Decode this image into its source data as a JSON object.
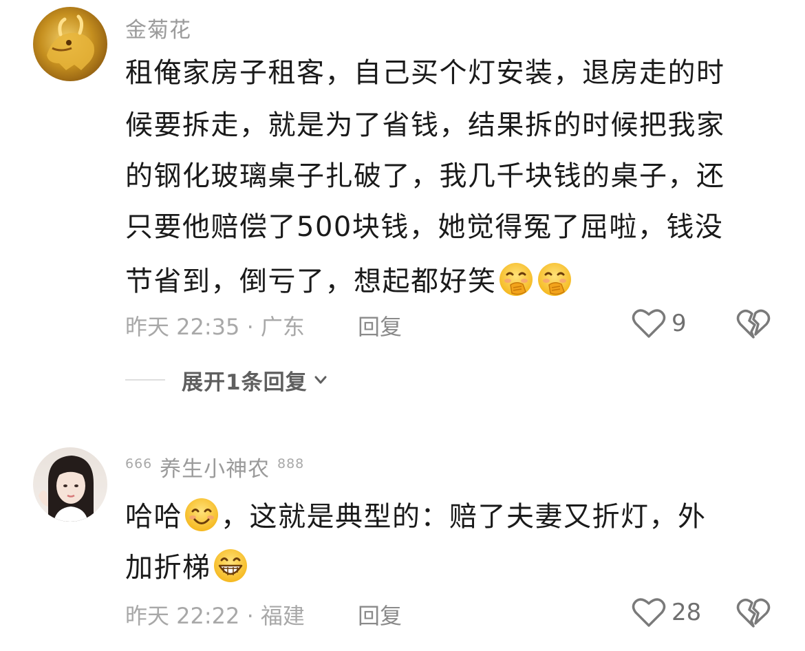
{
  "comments": [
    {
      "username": "金菊花",
      "avatar_icon": "golden-ox-avatar",
      "lines": [
        "租俺家房子租客，自己买个灯安装，退房走的时",
        "候要拆走，就是为了省钱，结果拆的时候把我家",
        "的钢化玻璃桌子扎破了，我几千块钱的桌子，还",
        "只要他赔偿了500块钱，她觉得冤了屈啦，钱没",
        "节省到，倒亏了，想起都好笑"
      ],
      "trailing_emojis": [
        "covering-mouth-laughing-emoji",
        "covering-mouth-laughing-emoji"
      ],
      "time_location": "昨天 22:35 · 广东",
      "reply_label": "回复",
      "like_count": "9",
      "expand_label": "展开1条回复"
    },
    {
      "badge_left": "666",
      "username": "养生小神农",
      "badge_right": "888",
      "avatar_icon": "girl-portrait-avatar",
      "line1_prefix": "哈哈",
      "line1_emoji": "smiling-face-emoji",
      "line1_suffix": "，这就是典型的：赔了夫妻又折灯，外",
      "line2_text": "加折梯",
      "line2_emoji": "grinning-face-emoji",
      "time_location": "昨天 22:22 · 福建",
      "reply_label": "回复",
      "like_count": "28"
    }
  ],
  "colors": {
    "meta": "#a8a8a8",
    "username": "#9b9b9b",
    "body": "#1a1a1a",
    "emoji": "#f7c234"
  }
}
